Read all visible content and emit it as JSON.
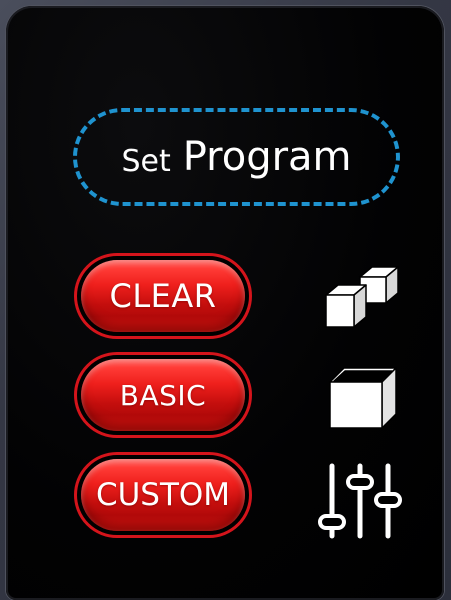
{
  "header": {
    "set_label": "Set",
    "program_label": "Program"
  },
  "buttons": [
    {
      "label": "CLEAR",
      "icon": "two-cubes-icon"
    },
    {
      "label": "BASIC",
      "icon": "cube-icon"
    },
    {
      "label": "CUSTOM",
      "icon": "sliders-icon"
    }
  ],
  "colors": {
    "background": "#000000",
    "bezel": "#3a3d4a",
    "accent_blue": "#1f93cf",
    "button_red": "#ee1f1c",
    "button_ring": "#d4141b",
    "text": "#ffffff"
  }
}
